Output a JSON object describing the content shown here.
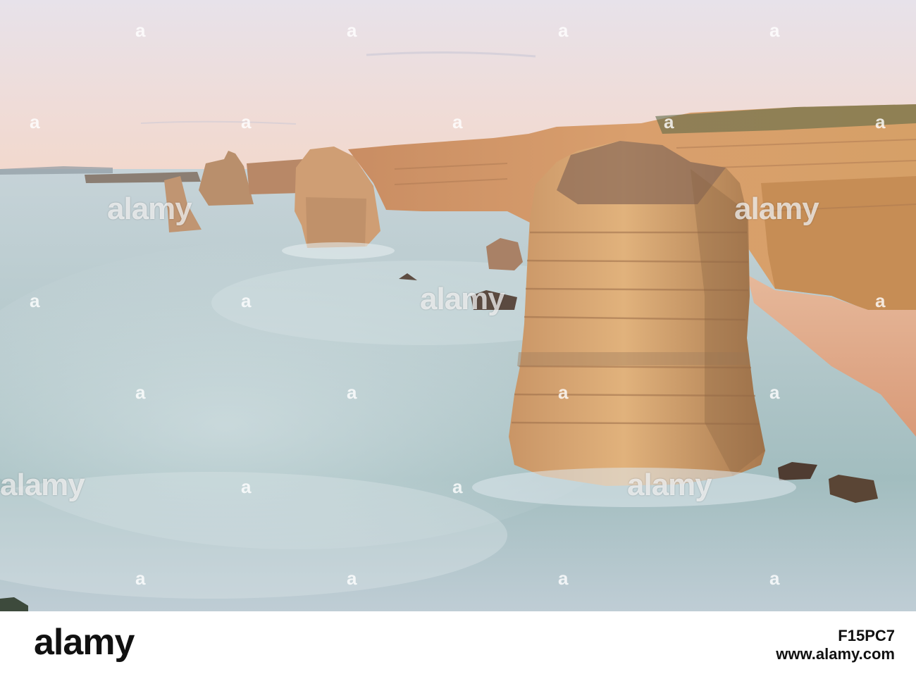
{
  "scene": {
    "description_colors": {
      "sky_top": "#e8dfe6",
      "sky_horizon": "#f1d8cc",
      "sea_light": "#cfd9df",
      "sea_mid": "#9fb9bd",
      "sea_dark": "#6f9598",
      "cliff_light": "#e6b37e",
      "cliff_mid": "#c98a55",
      "cliff_dark": "#7a5137",
      "sand": "#e8b08d"
    }
  },
  "watermark": {
    "word": "alamy",
    "mark": "a"
  },
  "footer": {
    "logo": "alamy",
    "image_id": "F15PC7",
    "site": "www.alamy.com"
  }
}
